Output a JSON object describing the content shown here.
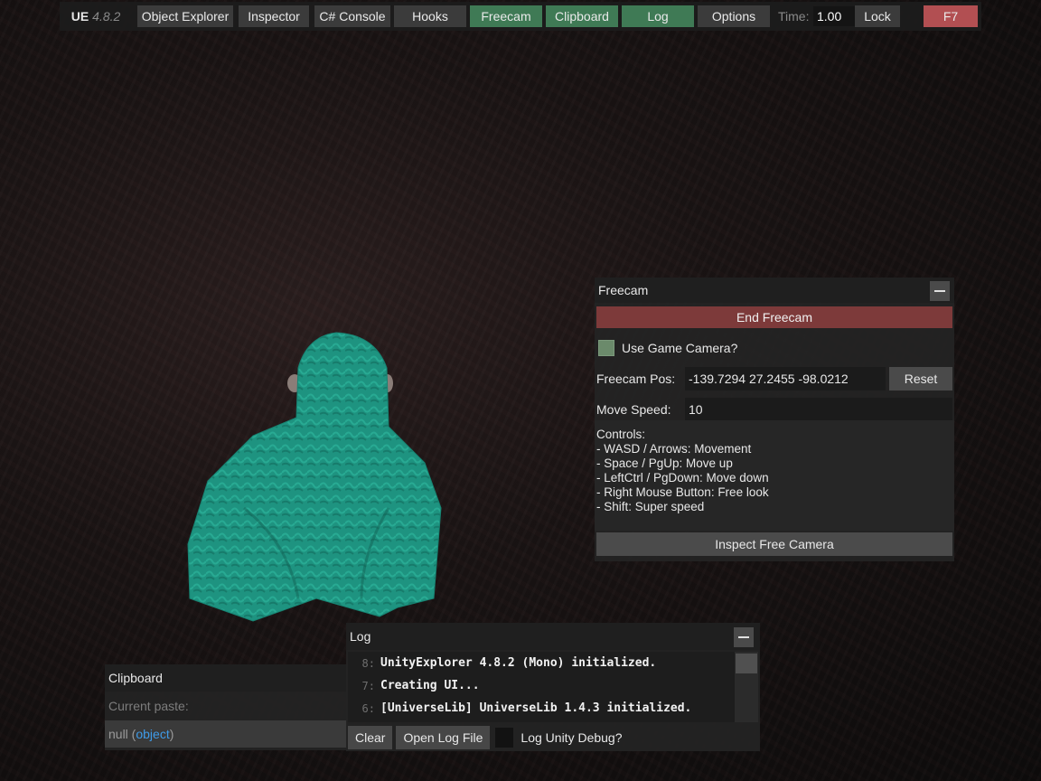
{
  "topbar": {
    "brand": "UE",
    "version": "4.8.2",
    "buttons": [
      {
        "label": "Object Explorer",
        "active": false
      },
      {
        "label": "Inspector",
        "active": false
      },
      {
        "label": "C# Console",
        "active": false
      },
      {
        "label": "Hooks",
        "active": false
      },
      {
        "label": "Freecam",
        "active": true
      },
      {
        "label": "Clipboard",
        "active": true
      },
      {
        "label": "Log",
        "active": true
      },
      {
        "label": "Options",
        "active": false
      }
    ],
    "time_label": "Time:",
    "time_value": "1.00",
    "lock_label": "Lock",
    "hotkey_label": "F7"
  },
  "freecam": {
    "title": "Freecam",
    "end_button": "End Freecam",
    "use_game_camera_label": "Use Game Camera?",
    "use_game_camera": false,
    "pos_label": "Freecam Pos:",
    "pos_value": "-139.7294 27.2455 -98.0212",
    "reset_label": "Reset",
    "speed_label": "Move Speed:",
    "speed_value": "10",
    "controls_text": "Controls:\n- WASD / Arrows: Movement\n- Space / PgUp: Move up\n- LeftCtrl / PgDown: Move down\n- Right Mouse Button: Free look\n- Shift: Super speed",
    "inspect_button": "Inspect Free Camera"
  },
  "clipboard": {
    "title": "Clipboard",
    "current_paste_label": "Current paste:",
    "value_null": "null",
    "value_type": "object"
  },
  "log": {
    "title": "Log",
    "lines": [
      {
        "num": "8:",
        "text": "UnityExplorer 4.8.2 (Mono) initialized."
      },
      {
        "num": "7:",
        "text": "Creating UI..."
      },
      {
        "num": "6:",
        "text": "[UniverseLib] UniverseLib 1.4.3 initialized."
      }
    ],
    "clear_label": "Clear",
    "open_file_label": "Open Log File",
    "unity_debug_label": "Log Unity Debug?"
  },
  "colors": {
    "active_tab": "#3f7a55",
    "danger": "#b24f52",
    "end_freecam": "#7d3a3a",
    "figure_teal": "#1f9a86"
  }
}
